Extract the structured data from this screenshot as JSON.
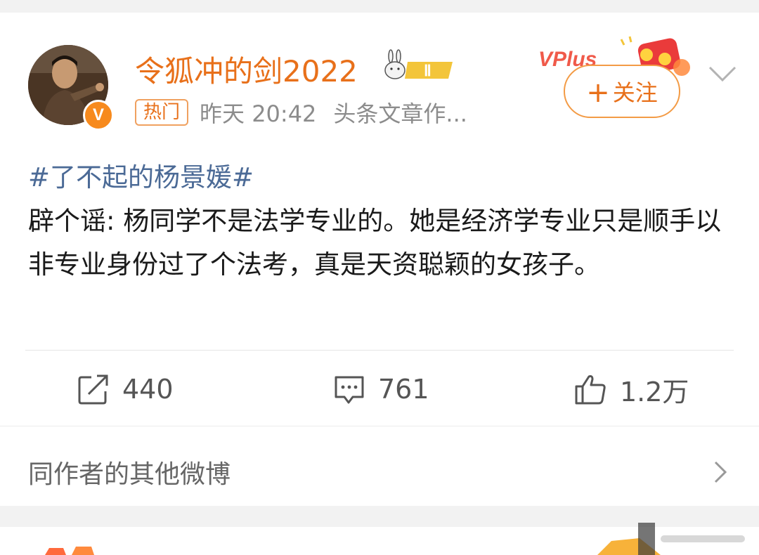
{
  "post": {
    "author": {
      "name": "令狐冲的剑2022",
      "level_badge": "Ⅱ",
      "verified_mark": "V",
      "avatar_icon": "avatar-photo"
    },
    "meta": {
      "tag": "热门",
      "time": "昨天 20:42",
      "source": "头条文章作..."
    },
    "follow": {
      "plus": "+",
      "label": "关注",
      "vplus_text": "VPlus"
    },
    "content": {
      "hashtag": "#了不起的杨景媛#",
      "body": "辟个谣: 杨同学不是法学专业的。她是经济学专业只是顺手以非专业身份过了个法考，真是天资聪颖的女孩子。"
    },
    "actions": {
      "repost": {
        "count": "440",
        "icon": "repost-icon"
      },
      "comment": {
        "count": "761",
        "icon": "comment-icon"
      },
      "like": {
        "count": "1.2万",
        "icon": "thumbs-up-icon"
      }
    }
  },
  "other_posts": {
    "label": "同作者的其他微博"
  },
  "colors": {
    "accent": "#e8701a",
    "hashtag": "#4b6a96",
    "meta": "#8c8c8c",
    "text": "#1a1a1a"
  }
}
